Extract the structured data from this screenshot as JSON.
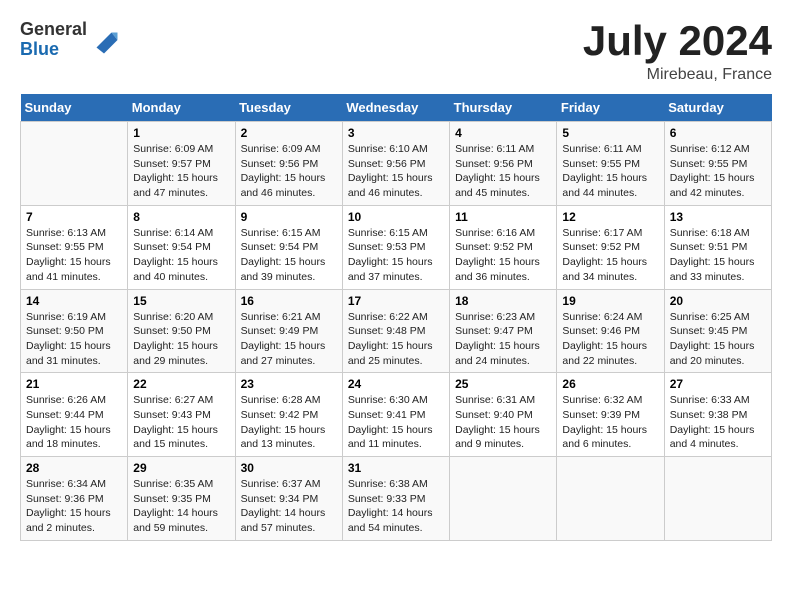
{
  "header": {
    "logo_general": "General",
    "logo_blue": "Blue",
    "title": "July 2024",
    "location": "Mirebeau, France"
  },
  "columns": [
    "Sunday",
    "Monday",
    "Tuesday",
    "Wednesday",
    "Thursday",
    "Friday",
    "Saturday"
  ],
  "weeks": [
    [
      {
        "day": "",
        "info": ""
      },
      {
        "day": "1",
        "info": "Sunrise: 6:09 AM\nSunset: 9:57 PM\nDaylight: 15 hours\nand 47 minutes."
      },
      {
        "day": "2",
        "info": "Sunrise: 6:09 AM\nSunset: 9:56 PM\nDaylight: 15 hours\nand 46 minutes."
      },
      {
        "day": "3",
        "info": "Sunrise: 6:10 AM\nSunset: 9:56 PM\nDaylight: 15 hours\nand 46 minutes."
      },
      {
        "day": "4",
        "info": "Sunrise: 6:11 AM\nSunset: 9:56 PM\nDaylight: 15 hours\nand 45 minutes."
      },
      {
        "day": "5",
        "info": "Sunrise: 6:11 AM\nSunset: 9:55 PM\nDaylight: 15 hours\nand 44 minutes."
      },
      {
        "day": "6",
        "info": "Sunrise: 6:12 AM\nSunset: 9:55 PM\nDaylight: 15 hours\nand 42 minutes."
      }
    ],
    [
      {
        "day": "7",
        "info": "Sunrise: 6:13 AM\nSunset: 9:55 PM\nDaylight: 15 hours\nand 41 minutes."
      },
      {
        "day": "8",
        "info": "Sunrise: 6:14 AM\nSunset: 9:54 PM\nDaylight: 15 hours\nand 40 minutes."
      },
      {
        "day": "9",
        "info": "Sunrise: 6:15 AM\nSunset: 9:54 PM\nDaylight: 15 hours\nand 39 minutes."
      },
      {
        "day": "10",
        "info": "Sunrise: 6:15 AM\nSunset: 9:53 PM\nDaylight: 15 hours\nand 37 minutes."
      },
      {
        "day": "11",
        "info": "Sunrise: 6:16 AM\nSunset: 9:52 PM\nDaylight: 15 hours\nand 36 minutes."
      },
      {
        "day": "12",
        "info": "Sunrise: 6:17 AM\nSunset: 9:52 PM\nDaylight: 15 hours\nand 34 minutes."
      },
      {
        "day": "13",
        "info": "Sunrise: 6:18 AM\nSunset: 9:51 PM\nDaylight: 15 hours\nand 33 minutes."
      }
    ],
    [
      {
        "day": "14",
        "info": "Sunrise: 6:19 AM\nSunset: 9:50 PM\nDaylight: 15 hours\nand 31 minutes."
      },
      {
        "day": "15",
        "info": "Sunrise: 6:20 AM\nSunset: 9:50 PM\nDaylight: 15 hours\nand 29 minutes."
      },
      {
        "day": "16",
        "info": "Sunrise: 6:21 AM\nSunset: 9:49 PM\nDaylight: 15 hours\nand 27 minutes."
      },
      {
        "day": "17",
        "info": "Sunrise: 6:22 AM\nSunset: 9:48 PM\nDaylight: 15 hours\nand 25 minutes."
      },
      {
        "day": "18",
        "info": "Sunrise: 6:23 AM\nSunset: 9:47 PM\nDaylight: 15 hours\nand 24 minutes."
      },
      {
        "day": "19",
        "info": "Sunrise: 6:24 AM\nSunset: 9:46 PM\nDaylight: 15 hours\nand 22 minutes."
      },
      {
        "day": "20",
        "info": "Sunrise: 6:25 AM\nSunset: 9:45 PM\nDaylight: 15 hours\nand 20 minutes."
      }
    ],
    [
      {
        "day": "21",
        "info": "Sunrise: 6:26 AM\nSunset: 9:44 PM\nDaylight: 15 hours\nand 18 minutes."
      },
      {
        "day": "22",
        "info": "Sunrise: 6:27 AM\nSunset: 9:43 PM\nDaylight: 15 hours\nand 15 minutes."
      },
      {
        "day": "23",
        "info": "Sunrise: 6:28 AM\nSunset: 9:42 PM\nDaylight: 15 hours\nand 13 minutes."
      },
      {
        "day": "24",
        "info": "Sunrise: 6:30 AM\nSunset: 9:41 PM\nDaylight: 15 hours\nand 11 minutes."
      },
      {
        "day": "25",
        "info": "Sunrise: 6:31 AM\nSunset: 9:40 PM\nDaylight: 15 hours\nand 9 minutes."
      },
      {
        "day": "26",
        "info": "Sunrise: 6:32 AM\nSunset: 9:39 PM\nDaylight: 15 hours\nand 6 minutes."
      },
      {
        "day": "27",
        "info": "Sunrise: 6:33 AM\nSunset: 9:38 PM\nDaylight: 15 hours\nand 4 minutes."
      }
    ],
    [
      {
        "day": "28",
        "info": "Sunrise: 6:34 AM\nSunset: 9:36 PM\nDaylight: 15 hours\nand 2 minutes."
      },
      {
        "day": "29",
        "info": "Sunrise: 6:35 AM\nSunset: 9:35 PM\nDaylight: 14 hours\nand 59 minutes."
      },
      {
        "day": "30",
        "info": "Sunrise: 6:37 AM\nSunset: 9:34 PM\nDaylight: 14 hours\nand 57 minutes."
      },
      {
        "day": "31",
        "info": "Sunrise: 6:38 AM\nSunset: 9:33 PM\nDaylight: 14 hours\nand 54 minutes."
      },
      {
        "day": "",
        "info": ""
      },
      {
        "day": "",
        "info": ""
      },
      {
        "day": "",
        "info": ""
      }
    ]
  ]
}
